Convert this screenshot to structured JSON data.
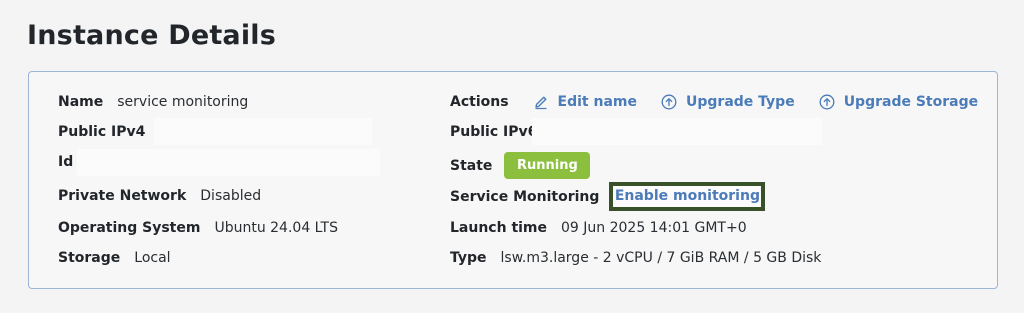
{
  "page": {
    "title": "Instance Details"
  },
  "left": [
    {
      "key": "name",
      "label": "Name",
      "value": "service monitoring"
    },
    {
      "key": "public_ipv4",
      "label": "Public IPv4",
      "value": ""
    },
    {
      "key": "id",
      "label": "Id",
      "value": ""
    },
    {
      "key": "private_network",
      "label": "Private Network",
      "value": "Disabled"
    },
    {
      "key": "operating_system",
      "label": "Operating System",
      "value": "Ubuntu 24.04 LTS"
    },
    {
      "key": "storage",
      "label": "Storage",
      "value": "Local"
    }
  ],
  "actions": {
    "label": "Actions",
    "edit_name": "Edit name",
    "upgrade_type": "Upgrade Type",
    "upgrade_storage": "Upgrade Storage"
  },
  "right": {
    "public_ipv6": {
      "label": "Public IPv6",
      "value": ""
    },
    "state": {
      "label": "State",
      "value": "Running"
    },
    "service_monitoring": {
      "label": "Service Monitoring",
      "link": "Enable monitoring"
    },
    "launch_time": {
      "label": "Launch time",
      "value": "09 Jun 2025 14:01 GMT+0"
    },
    "type": {
      "label": "Type",
      "value": "lsw.m3.large - 2 vCPU / 7 GiB RAM / 5 GB Disk"
    }
  },
  "colors": {
    "accent_link": "#4b7bb8",
    "running_badge": "#8cbf3d",
    "panel_border": "#9bb6d6",
    "highlight_border": "#38512a"
  },
  "icons": {
    "edit": "pencil-icon",
    "upgrade": "arrow-up-circle-icon"
  }
}
